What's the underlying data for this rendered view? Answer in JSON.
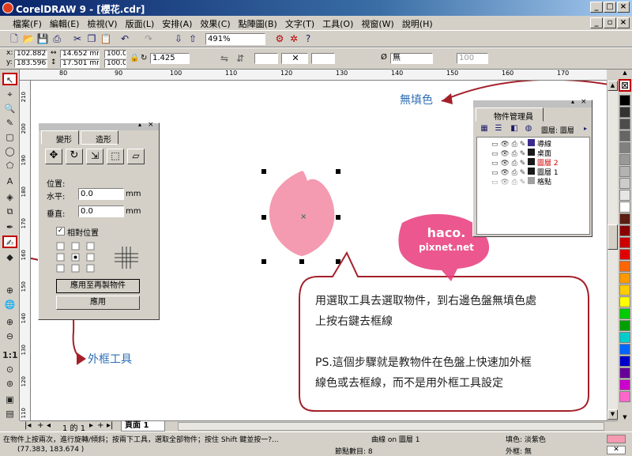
{
  "window": {
    "title": "CorelDRAW 9 - [櫻花.cdr]"
  },
  "menu": [
    "檔案(F)",
    "編輯(E)",
    "檢視(V)",
    "版面(L)",
    "安排(A)",
    "效果(C)",
    "點陣圖(B)",
    "文字(T)",
    "工具(O)",
    "視窗(W)",
    "說明(H)"
  ],
  "standard_toolbar": {
    "zoom": "491%"
  },
  "property_bar": {
    "x": "102.882 mm",
    "y": "183.596 mm",
    "width": "14.652 mm",
    "height": "17.501 mm",
    "scale_x": "100.0",
    "scale_y": "100.0",
    "angle": "1.425",
    "outline": "無",
    "opacity": "100"
  },
  "transform_panel": {
    "tabs": [
      "變形",
      "造形"
    ],
    "position_label": "位置:",
    "h_label": "水平:",
    "h_value": "0.0",
    "v_label": "垂直:",
    "v_value": "0.0",
    "unit": "mm",
    "relative_label": "相對位置",
    "relative_checked": true,
    "apply_copy_label": "應用至再製物件",
    "apply_label": "應用"
  },
  "object_manager": {
    "title": "物件管理員",
    "layer_label": "圖層: 圖層",
    "layers": [
      {
        "name": "導線",
        "color": "#3b2a8c",
        "active": false
      },
      {
        "name": "桌面",
        "color": "#1a1a1a",
        "active": false
      },
      {
        "name": "圖層 2",
        "color": "#1a1a1a",
        "active": true
      },
      {
        "name": "圖層 1",
        "color": "#1a1a1a",
        "active": false
      },
      {
        "name": "格點",
        "color": "#a0a0a0",
        "active": false
      }
    ]
  },
  "annotations": {
    "no_fill": "無填色",
    "outline_tool": "外框工具",
    "callout_line1": "用選取工具去選取物件，到右邊色盤無填色處",
    "callout_line2": "上按右鍵去框線",
    "callout_line3": "PS.這個步驟就是教物件在色盤上快速加外框",
    "callout_line4": "線色或去框線，而不是用外框工具設定",
    "watermark_line1": "haco.",
    "watermark_line2": "pixnet.net"
  },
  "rulers": {
    "top": [
      "80",
      "90",
      "100",
      "110",
      "120",
      "130",
      "140",
      "150",
      "160",
      "170"
    ],
    "left": [
      "210",
      "200",
      "190",
      "180",
      "170",
      "160",
      "150",
      "140",
      "130",
      "120",
      "110"
    ]
  },
  "pagebar": {
    "page_count": "1 的 1",
    "page_tab": "頁面 1"
  },
  "status": {
    "hint": "在物件上按兩次，進行旋轉/傾斜；按兩下工具，選取全部物件；按住 Shift 鍵並按一?...",
    "coords": "(77.383, 183.674 )",
    "object": "曲線 on 圖層 1",
    "nodes": "節點數目: 8",
    "fill": "填色: 淡紫色",
    "outline": "外框: 無"
  },
  "colors": {
    "petal": "#f49ab1",
    "annotation_blue": "#2f6fb4",
    "arrow_red": "#a3202a",
    "palette": [
      "#000000",
      "#333333",
      "#4d4d4d",
      "#666666",
      "#808080",
      "#999999",
      "#b3b3b3",
      "#cccccc",
      "#e6e6e6",
      "#ffffff",
      "#5c1d12",
      "#8b0000",
      "#cc0000",
      "#e00000",
      "#ff6600",
      "#ff9900",
      "#ffcc00",
      "#ffff00",
      "#00cc00",
      "#00a000",
      "#00cccc",
      "#0066ff",
      "#0000cc",
      "#660099",
      "#cc00cc",
      "#ff66cc"
    ]
  }
}
